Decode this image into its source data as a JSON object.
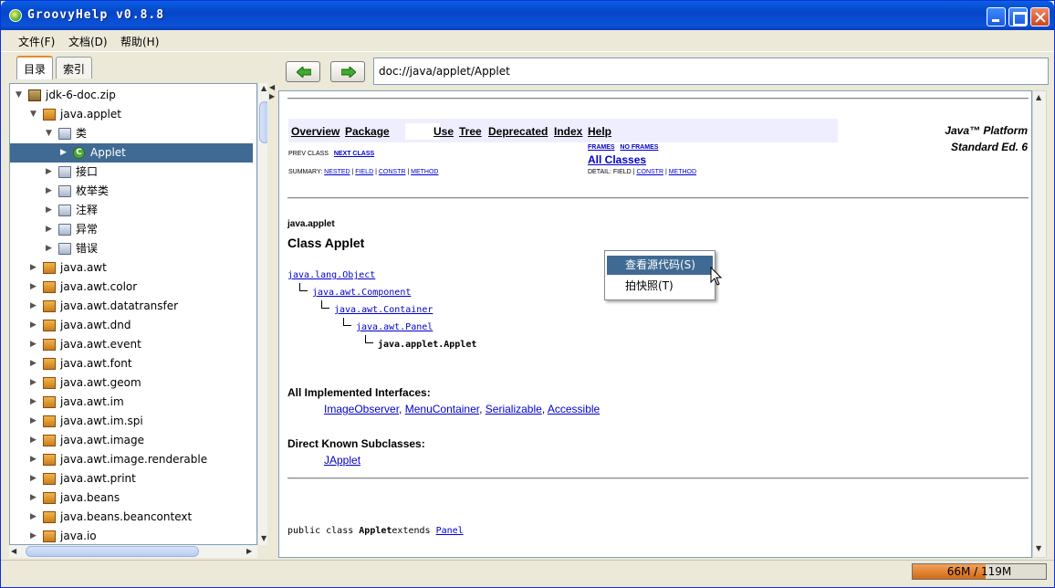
{
  "window": {
    "title": "GroovyHelp v0.8.8"
  },
  "menu": {
    "file": "文件(F)",
    "doc": "文档(D)",
    "help": "帮助(H)"
  },
  "left_tabs": {
    "toc": "目录",
    "index": "索引"
  },
  "tree": [
    {
      "label": "jdk-6-doc.zip",
      "level": 0,
      "icon": "zip-icon",
      "expanded": true
    },
    {
      "label": "java.applet",
      "level": 1,
      "icon": "package-icon",
      "expanded": true
    },
    {
      "label": "类",
      "level": 2,
      "icon": "folder-icon",
      "expanded": true
    },
    {
      "label": "Applet",
      "level": 3,
      "icon": "class-icon",
      "expanded": false,
      "selected": true
    },
    {
      "label": "接口",
      "level": 2,
      "icon": "folder-icon",
      "expanded": false
    },
    {
      "label": "枚举类",
      "level": 2,
      "icon": "folder-icon",
      "expanded": false
    },
    {
      "label": "注释",
      "level": 2,
      "icon": "folder-icon",
      "expanded": false
    },
    {
      "label": "异常",
      "level": 2,
      "icon": "folder-icon",
      "expanded": false
    },
    {
      "label": "错误",
      "level": 2,
      "icon": "folder-icon",
      "expanded": false
    },
    {
      "label": "java.awt",
      "level": 1,
      "icon": "package-icon",
      "expanded": false
    },
    {
      "label": "java.awt.color",
      "level": 1,
      "icon": "package-icon",
      "expanded": false
    },
    {
      "label": "java.awt.datatransfer",
      "level": 1,
      "icon": "package-icon",
      "expanded": false
    },
    {
      "label": "java.awt.dnd",
      "level": 1,
      "icon": "package-icon",
      "expanded": false
    },
    {
      "label": "java.awt.event",
      "level": 1,
      "icon": "package-icon",
      "expanded": false
    },
    {
      "label": "java.awt.font",
      "level": 1,
      "icon": "package-icon",
      "expanded": false
    },
    {
      "label": "java.awt.geom",
      "level": 1,
      "icon": "package-icon",
      "expanded": false
    },
    {
      "label": "java.awt.im",
      "level": 1,
      "icon": "package-icon",
      "expanded": false
    },
    {
      "label": "java.awt.im.spi",
      "level": 1,
      "icon": "package-icon",
      "expanded": false
    },
    {
      "label": "java.awt.image",
      "level": 1,
      "icon": "package-icon",
      "expanded": false
    },
    {
      "label": "java.awt.image.renderable",
      "level": 1,
      "icon": "package-icon",
      "expanded": false
    },
    {
      "label": "java.awt.print",
      "level": 1,
      "icon": "package-icon",
      "expanded": false
    },
    {
      "label": "java.beans",
      "level": 1,
      "icon": "package-icon",
      "expanded": false
    },
    {
      "label": "java.beans.beancontext",
      "level": 1,
      "icon": "package-icon",
      "expanded": false
    },
    {
      "label": "java.io",
      "level": 1,
      "icon": "package-icon",
      "expanded": false
    }
  ],
  "toolbar": {
    "back_icon": "arrow-left-icon",
    "forward_icon": "arrow-right-icon",
    "address": "doc://java/applet/Applet"
  },
  "doc": {
    "nav": {
      "overview": "Overview",
      "package": "Package",
      "use": "Use",
      "tree": "Tree",
      "deprecated": "Deprecated",
      "index": "Index",
      "help": "Help"
    },
    "platform_line1": "Java™ Platform",
    "platform_line2": "Standard Ed. 6",
    "prev_class": "PREV CLASS",
    "next_class": "NEXT CLASS",
    "frames": "FRAMES",
    "no_frames": "NO FRAMES",
    "all_classes": "All Classes",
    "summary_label": "SUMMARY:",
    "summary_nested": "NESTED",
    "summary_field": "FIELD",
    "summary_constr": "CONSTR",
    "summary_method": "METHOD",
    "detail_label": "DETAIL: FIELD",
    "detail_constr": "CONSTR",
    "detail_method": "METHOD",
    "package_name": "java.applet",
    "class_title": "Class Applet",
    "inheritance": [
      "java.lang.Object",
      "java.awt.Component",
      "java.awt.Container",
      "java.awt.Panel",
      "java.applet.Applet"
    ],
    "interfaces_head": "All Implemented Interfaces:",
    "interfaces": [
      "ImageObserver",
      "MenuContainer",
      "Serializable",
      "Accessible"
    ],
    "subclasses_head": "Direct Known Subclasses:",
    "subclasses": [
      "JApplet"
    ],
    "decl_prefix": "public class ",
    "decl_class": "Applet",
    "decl_extends": "extends ",
    "decl_super": "Panel"
  },
  "context_menu": {
    "view_source": "查看源代码(S)",
    "snapshot": "拍快照(T)"
  },
  "status": {
    "memory_text": "66M / 119M",
    "memory_used_fraction": 0.55
  }
}
